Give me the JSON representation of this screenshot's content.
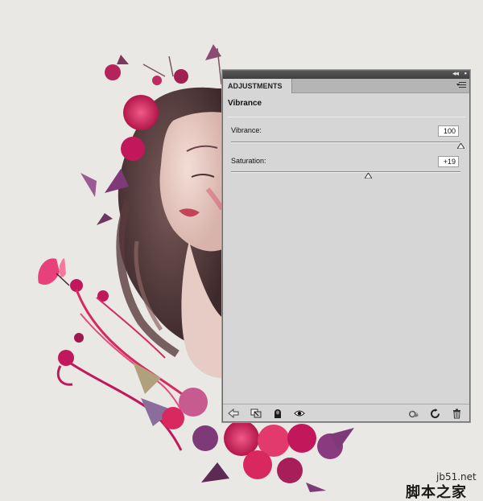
{
  "panel": {
    "tab_label": "ADJUSTMENTS",
    "section_title": "Vibrance",
    "sliders": [
      {
        "label": "Vibrance:",
        "display": "100",
        "value": 100,
        "min": -100,
        "max": 100
      },
      {
        "label": "Saturation:",
        "display": "+19",
        "value": 19,
        "min": -100,
        "max": 100
      }
    ],
    "bottom_icons_left": [
      "back-arrow-icon",
      "clip-to-layer-icon",
      "visibility-toggle-icon",
      "eye-icon"
    ],
    "bottom_icons_right": [
      "view-previous-icon",
      "reset-icon",
      "trash-icon"
    ]
  },
  "watermark": {
    "site": "jb51.net",
    "brand": "脚本之家"
  },
  "colors": {
    "panel_bg": "#d6d6d6",
    "titlebar": "#4a4a4a",
    "canvas_bg": "#e9e8e4",
    "flower_pink": "#d8285f",
    "flower_purple": "#7e3a78"
  }
}
